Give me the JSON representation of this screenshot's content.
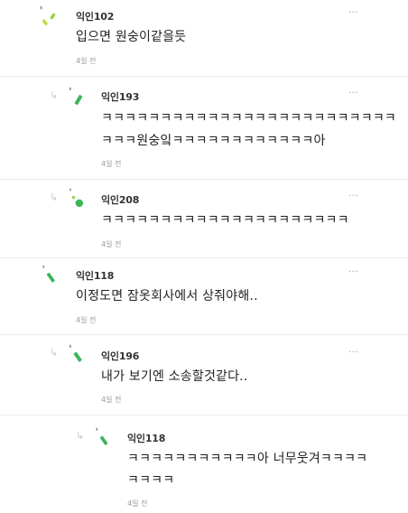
{
  "comments": [
    {
      "author": "익인102",
      "text": [
        "입으면 원숭이같을듯"
      ],
      "time": "4일 전",
      "is_reply": false,
      "avatar": "a"
    },
    {
      "author": "익인193",
      "text": [
        "ㅋㅋㅋㅋㅋㅋㅋㅋㅋㅋㅋㅋㅋㅋㅋㅋㅋㅋㅋㅋㅋㅋㅋㅋㅋ",
        "ㅋㅋㅋ원숭잌ㅋㅋㅋㅋㅋㅋㅋㅋㅋㅋㅋㅋ아"
      ],
      "time": "4일 전",
      "is_reply": true,
      "avatar": "b"
    },
    {
      "author": "익인208",
      "text": [
        "ㅋㅋㅋㅋㅋㅋㅋㅋㅋㅋㅋㅋㅋㅋㅋㅋㅋㅋㅋㅋㅋ"
      ],
      "time": "4일 전",
      "is_reply": true,
      "avatar": "c"
    },
    {
      "author": "익인118",
      "text": [
        "이정도면 잠옷회사에서 상줘야해.."
      ],
      "time": "4일 전",
      "is_reply": false,
      "avatar": "d"
    },
    {
      "author": "익인196",
      "text": [
        "내가 보기엔 소송할것같다.."
      ],
      "time": "4일 전",
      "is_reply": true,
      "avatar": "e"
    },
    {
      "author": "익인118",
      "text": [
        "ㅋㅋㅋㅋㅋㅋㅋㅋㅋㅋㅋ아 너무웃겨ㅋㅋㅋㅋ",
        "ㅋㅋㅋㅋ"
      ],
      "time": "4일 전",
      "is_reply": true,
      "avatar": "d"
    }
  ],
  "more_label": "···",
  "reply_glyph": "↳",
  "colors": {
    "accent_green": "#3bb55a",
    "light_green": "#9ccf4a",
    "yellow_green": "#c7d847"
  }
}
